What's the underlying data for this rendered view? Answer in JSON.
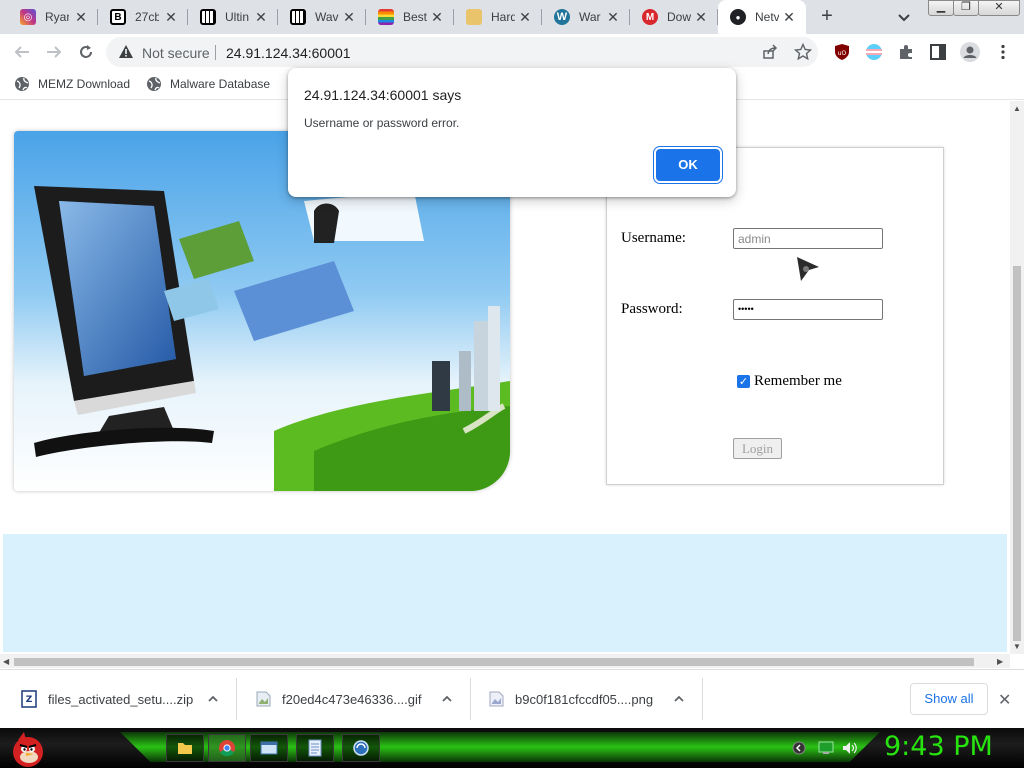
{
  "tabs": [
    {
      "title": "Ryan",
      "icon": "instagram-icon",
      "color": "#c13584"
    },
    {
      "title": "27cb",
      "icon": "bold-b-icon",
      "color": "#000000"
    },
    {
      "title": "Ultin",
      "icon": "piano-icon",
      "color": "#000000"
    },
    {
      "title": "Wav",
      "icon": "piano-icon",
      "color": "#000000"
    },
    {
      "title": "Best",
      "icon": "rainbow-flag-icon",
      "color": "#e53935"
    },
    {
      "title": "Hard",
      "icon": "folder-image-icon",
      "color": "#d9a441"
    },
    {
      "title": "War",
      "icon": "wordpress-icon",
      "color": "#21759b"
    },
    {
      "title": "Dow",
      "icon": "mega-icon",
      "color": "#d9272e"
    },
    {
      "title": "Netv",
      "icon": "dark-circle-icon",
      "color": "#202124"
    }
  ],
  "toolbar": {
    "security_label": "Not secure",
    "url": "24.91.124.34:60001"
  },
  "bookmarks": [
    {
      "label": "MEMZ Download"
    },
    {
      "label": "Malware Database"
    }
  ],
  "login": {
    "username_label": "Username:",
    "username_placeholder": "admin",
    "password_label": "Password:",
    "password_value": "•••••",
    "remember_label": "Remember me",
    "remember_checked": true,
    "login_button": "Login"
  },
  "alert": {
    "title": "24.91.124.34:60001 says",
    "message": "Username or password error.",
    "ok_label": "OK"
  },
  "downloads": [
    {
      "name": "files_activated_setu....zip",
      "icon": "zip-file-icon"
    },
    {
      "name": "f20ed4c473e46336....gif",
      "icon": "image-file-icon"
    },
    {
      "name": "b9c0f181cfccdf05....png",
      "icon": "image-file-icon"
    }
  ],
  "download_bar": {
    "show_all": "Show all"
  },
  "taskbar": {
    "clock": "9:43 PM",
    "accent": "#27e40f"
  }
}
